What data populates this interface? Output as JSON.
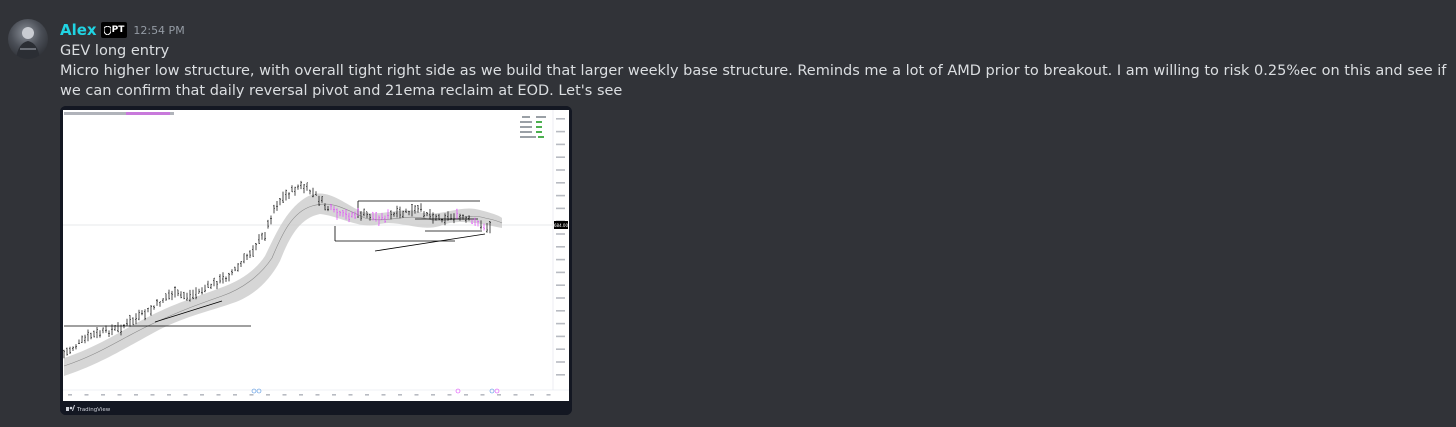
{
  "message": {
    "author": "Alex",
    "role_tag": "PT",
    "timestamp": "12:54 PM",
    "lines": [
      "GEV long entry",
      "Micro higher low structure, with overall tight right side as we build that larger weekly base structure. Reminds me a lot of AMD prior to breakout. I am willing to risk 0.25%ec on this and see if we can confirm that daily reversal pivot and 21ema reclaim at EOD. Let's see"
    ]
  },
  "chart_card": {
    "brand": "TradingView",
    "price_tag": "684.00"
  },
  "colors": {
    "background": "#313338",
    "username": "#20d4e3",
    "text": "#dbdee1",
    "timestamp": "#949ba4",
    "bar_normal": "#000000",
    "bar_highlight": "#e040fb"
  },
  "icons": [
    "tag-shield-icon",
    "tradingview-logo-icon",
    "event-marker-icon"
  ]
}
